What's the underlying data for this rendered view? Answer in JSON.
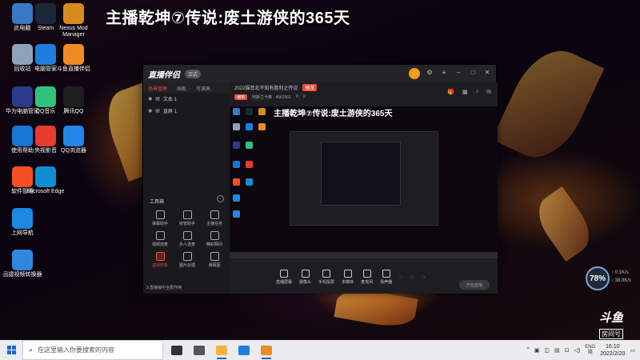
{
  "stream_title": "主播乾坤⑦传说:废土游侠的365天",
  "desktop_icons": [
    {
      "label": "此电脑",
      "icon": "computer-icon",
      "color": "#3a78c8"
    },
    {
      "label": "Steam",
      "icon": "steam-icon",
      "color": "#1b2838"
    },
    {
      "label": "Nexus Mod Manager",
      "icon": "nexus-mod-manager-icon",
      "color": "#d98a1c"
    },
    {
      "label": "回收站",
      "icon": "recycle-bin-icon",
      "color": "#8fa3b8"
    },
    {
      "label": "电脑管家",
      "icon": "pc-manager-icon",
      "color": "#1f7de0"
    },
    {
      "label": "斗鱼直播伴侣",
      "icon": "douyu-companion-icon",
      "color": "#f08a22"
    },
    {
      "label": "华为电脑管家",
      "icon": "huawei-pc-manager-icon",
      "color": "#2b3a8c"
    },
    {
      "label": "QQ音乐",
      "icon": "qq-music-icon",
      "color": "#31c27c"
    },
    {
      "label": "腾讯QQ",
      "icon": "tencent-qq-icon",
      "color": "#1e1e1e"
    },
    {
      "label": "使用帮助",
      "icon": "help-icon",
      "color": "#1976d2"
    },
    {
      "label": "央视影音",
      "icon": "cctv-video-icon",
      "color": "#e63b2e"
    },
    {
      "label": "QQ浏览器",
      "icon": "qq-browser-icon",
      "color": "#2286e8"
    },
    {
      "label": "软件管理",
      "icon": "software-manager-icon",
      "color": "#f25022"
    },
    {
      "label": "Microsoft Edge",
      "icon": "edge-icon",
      "color": "#0f8fd0"
    },
    {
      "label": "上网导航",
      "icon": "ie-icon",
      "color": "#1e88e5"
    },
    {
      "label": "迅捷视频转换器",
      "icon": "video-converter-icon",
      "color": "#2f86de"
    }
  ],
  "app": {
    "logo": "直播伴侣",
    "badge": "正式",
    "tabs": [
      "场景管理",
      "画板",
      "可滚高"
    ],
    "scenes": [
      "文本 1",
      "直屏 1"
    ],
    "tools_title": "工具箱",
    "tools": [
      "弹幕助手",
      "房管助手",
      "主播任务",
      "视频连麦",
      "多人连麦",
      "精彩瞬间",
      "虚拟形象",
      "图片处理",
      "弹幕图"
    ],
    "active_tool_index": 6,
    "status": "3.直播接中全局作用",
    "preview_header": "2022猫耳北不知有胜利之传说",
    "preview_tag": "预览",
    "preview_sub": [
      "编辑",
      "阿斯兰卡奥 · 4562001",
      "0",
      "0"
    ],
    "bottom_tools": [
      "直播屏幕",
      "摄像头",
      "手机投屏",
      "多媒体",
      "麦克风",
      "扬声器"
    ],
    "live_button": "开始直播"
  },
  "overlay": {
    "net_percent": "78%",
    "upload_speed": "↑ 0.1K/s",
    "download_speed": "↓ 38.8K/s",
    "watermark_brand": "斗鱼",
    "watermark_room": "房间号"
  },
  "taskbar": {
    "search_placeholder": "在这里输入你要搜索的内容",
    "apps": [
      {
        "icon": "task-view-icon",
        "color": "#333333",
        "running": false
      },
      {
        "icon": "taskbar-app-icon",
        "color": "#555555",
        "running": false
      },
      {
        "icon": "file-explorer-icon",
        "color": "#f2b33d",
        "running": true
      },
      {
        "icon": "mail-icon",
        "color": "#1f7de0",
        "running": false
      },
      {
        "icon": "douyu-companion-icon",
        "color": "#f08a22",
        "running": true
      }
    ],
    "ime": [
      "ENG",
      "简"
    ],
    "time": "16:10",
    "date": "2022/2/20"
  }
}
